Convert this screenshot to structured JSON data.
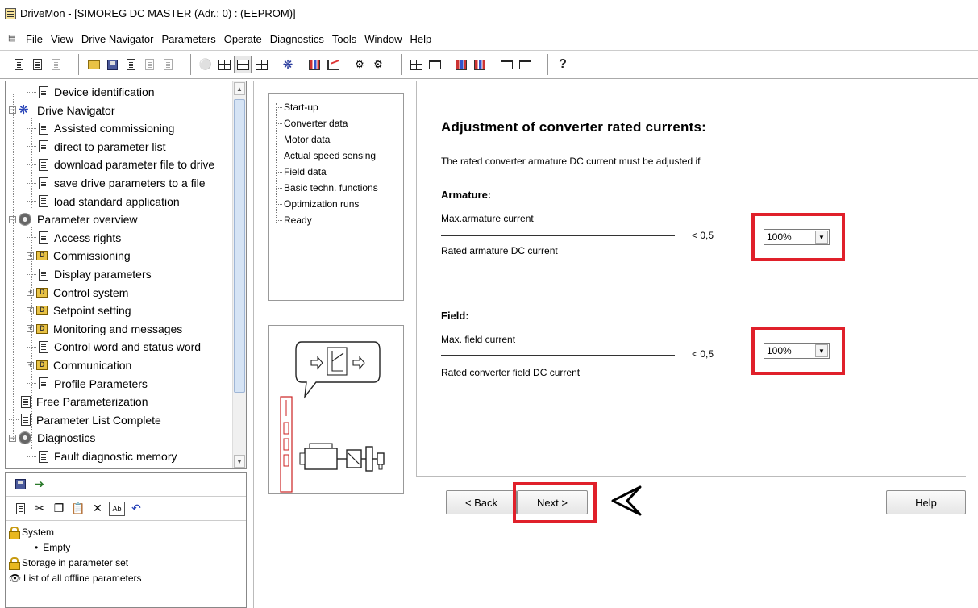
{
  "window": {
    "title": "DriveMon - [SIMOREG DC MASTER  (Adr.: 0) : (EEPROM)]"
  },
  "menu": [
    "File",
    "View",
    "Drive Navigator",
    "Parameters",
    "Operate",
    "Diagnostics",
    "Tools",
    "Window",
    "Help"
  ],
  "tree": [
    {
      "label": "Device identification",
      "level": 1,
      "icon": "doc-icon"
    },
    {
      "label": "Drive Navigator",
      "level": 0,
      "icon": "navigator-icon",
      "expander": "-"
    },
    {
      "label": "Assisted commissioning",
      "level": 1,
      "icon": "doc-icon"
    },
    {
      "label": "direct to parameter list",
      "level": 1,
      "icon": "doc-icon"
    },
    {
      "label": "download parameter file to drive",
      "level": 1,
      "icon": "doc-icon"
    },
    {
      "label": "save drive parameters to a file",
      "level": 1,
      "icon": "doc-icon"
    },
    {
      "label": "load standard application",
      "level": 1,
      "icon": "doc-icon"
    },
    {
      "label": "Parameter overview",
      "level": 0,
      "icon": "gear-icon",
      "expander": "-"
    },
    {
      "label": "Access rights",
      "level": 1,
      "icon": "doc-icon"
    },
    {
      "label": "Commissioning",
      "level": 1,
      "icon": "folder-icon",
      "expander": "+"
    },
    {
      "label": "Display parameters",
      "level": 1,
      "icon": "doc-icon"
    },
    {
      "label": "Control system",
      "level": 1,
      "icon": "folder-icon",
      "expander": "+"
    },
    {
      "label": "Setpoint setting",
      "level": 1,
      "icon": "folder-icon",
      "expander": "+"
    },
    {
      "label": "Monitoring and messages",
      "level": 1,
      "icon": "folder-icon",
      "expander": "+"
    },
    {
      "label": "Control word and status word",
      "level": 1,
      "icon": "doc-icon"
    },
    {
      "label": "Communication",
      "level": 1,
      "icon": "folder-icon",
      "expander": "+"
    },
    {
      "label": "Profile Parameters",
      "level": 1,
      "icon": "doc-icon"
    },
    {
      "label": "Free Parameterization",
      "level": 0,
      "icon": "doc-icon"
    },
    {
      "label": "Parameter List Complete",
      "level": 0,
      "icon": "doc-icon"
    },
    {
      "label": "Diagnostics",
      "level": 0,
      "icon": "gear-icon",
      "expander": "-"
    },
    {
      "label": "Fault diagnostic memory",
      "level": 1,
      "icon": "doc-icon"
    }
  ],
  "lower_panel": {
    "items": [
      {
        "label": "System",
        "icon": "lock-icon"
      },
      {
        "label": "Empty",
        "icon": "bullet-icon"
      },
      {
        "label": "Storage in parameter set",
        "icon": "lock-icon"
      },
      {
        "label": "List of all offline parameters",
        "icon": "eye-icon"
      }
    ]
  },
  "wizard_steps": [
    "Start-up",
    "Converter data",
    "Motor data",
    "Actual speed sensing",
    "Field data",
    "Basic techn. functions",
    "Optimization runs",
    "Ready"
  ],
  "content": {
    "heading": "Adjustment of converter rated currents:",
    "intro": "The rated converter armature DC current must be adjusted if",
    "armature": {
      "title": "Armature:",
      "numerator": "Max.armature current",
      "denominator": "Rated armature DC current",
      "condition": "< 0,5",
      "select_value": "100%"
    },
    "field": {
      "title": "Field:",
      "numerator": "Max. field current",
      "denominator": "Rated converter field DC current",
      "condition": "< 0,5",
      "select_value": "100%"
    }
  },
  "buttons": {
    "back": "< Back",
    "next": "Next >",
    "help": "Help"
  },
  "colors": {
    "highlight": "#e0202a",
    "navigator": "#2642b8"
  }
}
